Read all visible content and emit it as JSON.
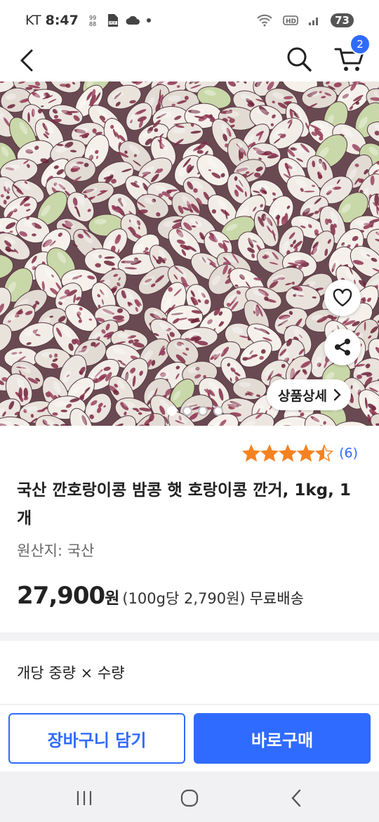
{
  "status_bar": {
    "carrier": "KT",
    "time": "8:47",
    "battery": "73",
    "left_icons": [
      "dual-sim-icon",
      "pdf-file-icon",
      "cloud-icon",
      "notification-dot-icon"
    ],
    "right_icons": [
      "wifi-icon",
      "hd-icon",
      "signal-icon"
    ]
  },
  "header": {
    "cart_count": "2",
    "icons": [
      "back-arrow-icon",
      "search-icon",
      "cart-icon"
    ]
  },
  "gallery": {
    "detail_button_label": "상품상세",
    "total_images": 4,
    "active_index": 0
  },
  "product": {
    "rating_stars": 4.5,
    "review_count": "(6)",
    "title": "국산 깐호랑이콩 밤콩 햇 호랑이콩 깐거, 1kg, 1개",
    "origin": "원산지: 국산",
    "price": "27,900",
    "price_unit": "원",
    "unit_price": "(100g당 2,790원)",
    "shipping": "무료배송"
  },
  "option": {
    "label": "개당 중량 × 수량"
  },
  "actions": {
    "add_to_cart": "장바구니 담기",
    "buy_now": "바로구매"
  },
  "colors": {
    "accent": "#2f6bff",
    "star": "#f58220",
    "text": "#222222",
    "muted": "#666666"
  }
}
